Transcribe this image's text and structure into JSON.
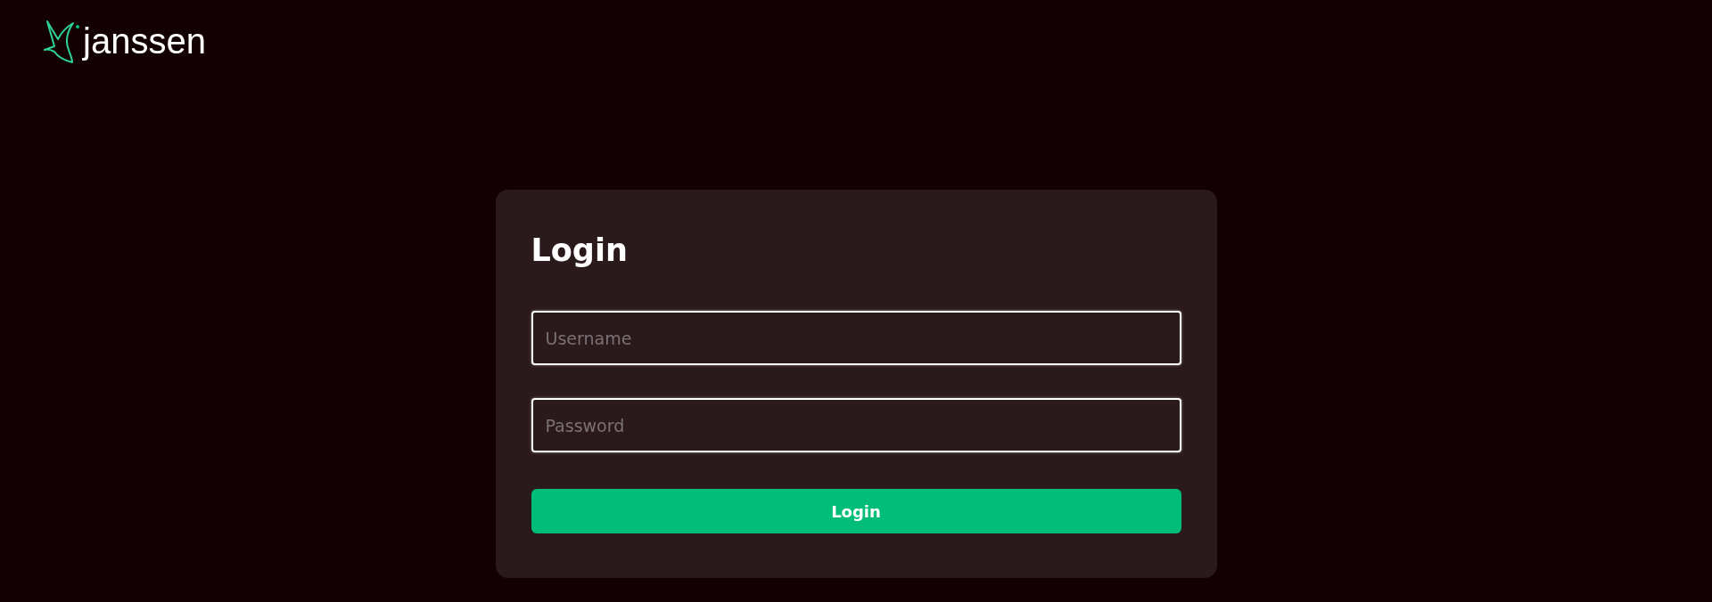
{
  "logo": {
    "text": "janssen"
  },
  "card": {
    "title": "Login",
    "fields": [
      {
        "placeholder": "Username"
      },
      {
        "placeholder": "Password"
      }
    ],
    "button": "Login"
  }
}
